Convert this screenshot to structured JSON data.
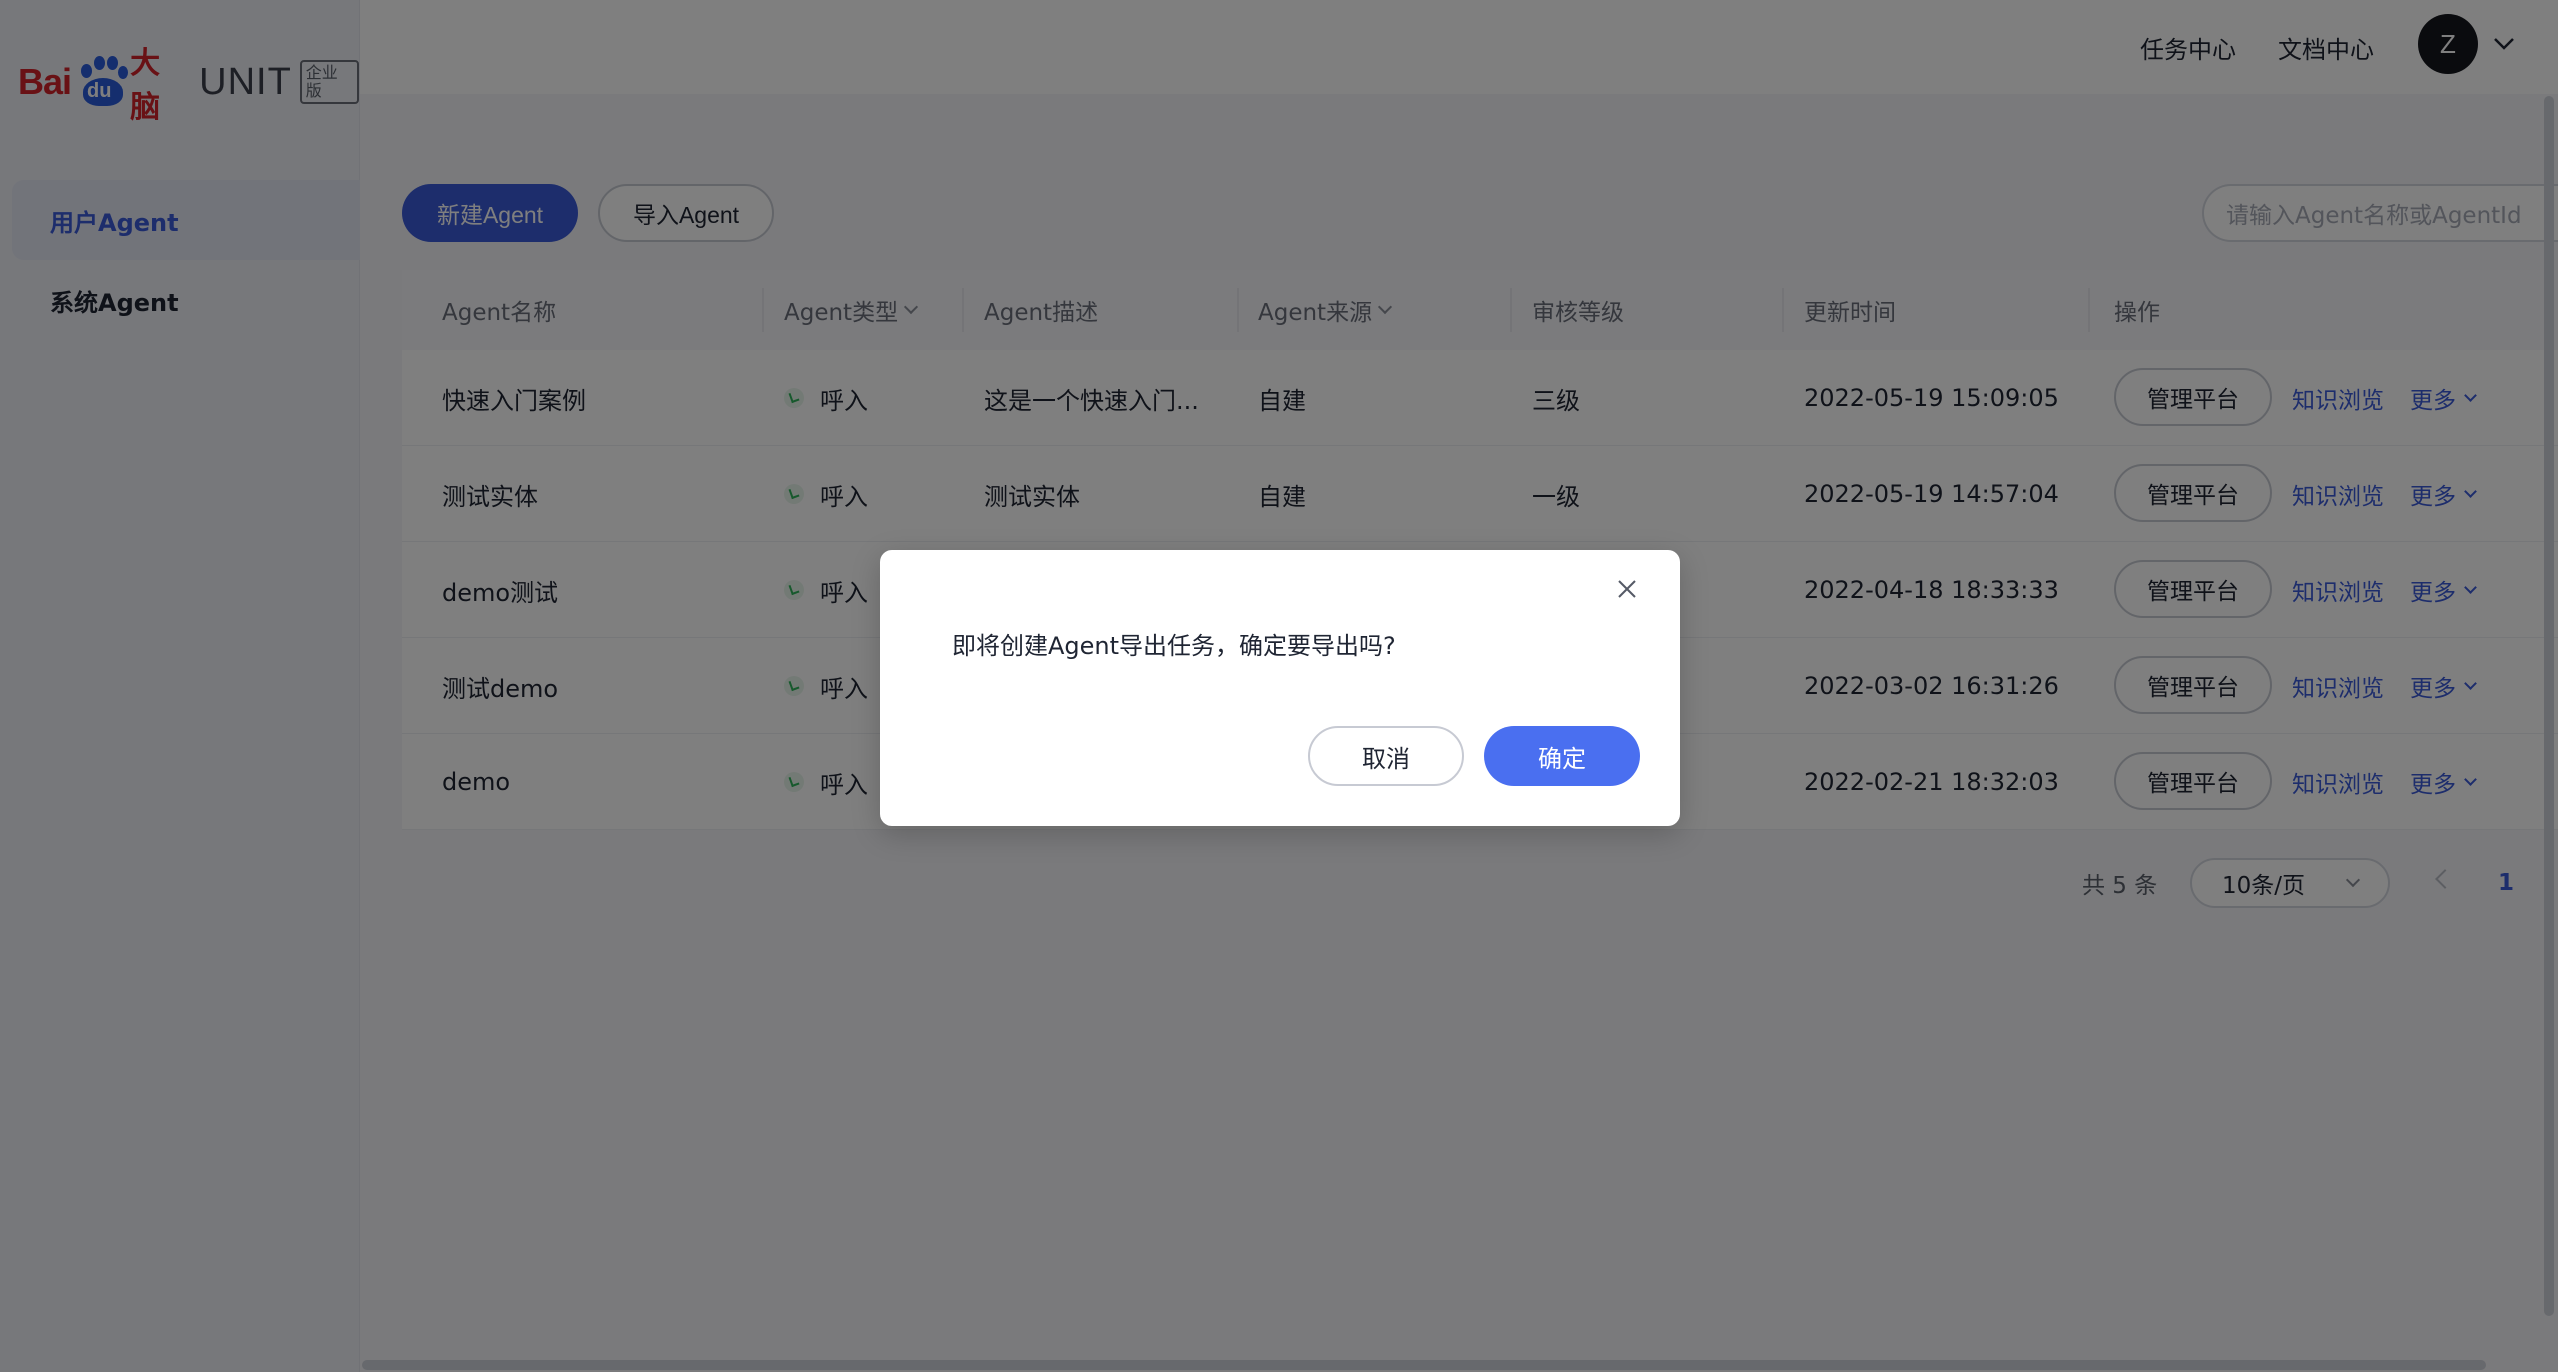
{
  "logo": {
    "bai": "Bai",
    "du": "du",
    "brain": "大脑",
    "unit": "UNIT",
    "edition": "企业版"
  },
  "sidebar": {
    "items": [
      {
        "label": "用户Agent",
        "active": true
      },
      {
        "label": "系统Agent",
        "active": false
      }
    ]
  },
  "header": {
    "links": [
      "任务中心",
      "文档中心"
    ],
    "avatar_initial": "Z"
  },
  "toolbar": {
    "new_label": "新建Agent",
    "import_label": "导入Agent",
    "search_placeholder": "请输入Agent名称或AgentId"
  },
  "table": {
    "headers": [
      "Agent名称",
      "Agent类型",
      "Agent描述",
      "Agent来源",
      "审核等级",
      "更新时间",
      "操作"
    ],
    "rows": [
      {
        "name": "快速入门案例",
        "type": "呼入",
        "desc": "这是一个快速入门...",
        "source": "自建",
        "level": "三级",
        "time": "2022-05-19 15:09:05"
      },
      {
        "name": "测试实体",
        "type": "呼入",
        "desc": "测试实体",
        "source": "自建",
        "level": "一级",
        "time": "2022-05-19 14:57:04"
      },
      {
        "name": "demo测试",
        "type": "呼入",
        "desc": "",
        "source": "",
        "level": "",
        "time": "2022-04-18 18:33:33"
      },
      {
        "name": "测试demo",
        "type": "呼入",
        "desc": "",
        "source": "",
        "level": "",
        "time": "2022-03-02 16:31:26"
      },
      {
        "name": "demo",
        "type": "呼入",
        "desc": "",
        "source": "",
        "level": "",
        "time": "2022-02-21 18:32:03"
      }
    ],
    "actions": {
      "manage": "管理平台",
      "knowledge": "知识浏览",
      "more": "更多"
    }
  },
  "pagination": {
    "total": "共 5 条",
    "page_size": "10条/页",
    "current": "1"
  },
  "dialog": {
    "message": "即将创建Agent导出任务，确定要导出吗?",
    "cancel": "取消",
    "ok": "确定"
  },
  "colors": {
    "primary": "#3a5ad8",
    "dialog_ok": "#4a6ff0",
    "brand_red": "#d2232a"
  }
}
